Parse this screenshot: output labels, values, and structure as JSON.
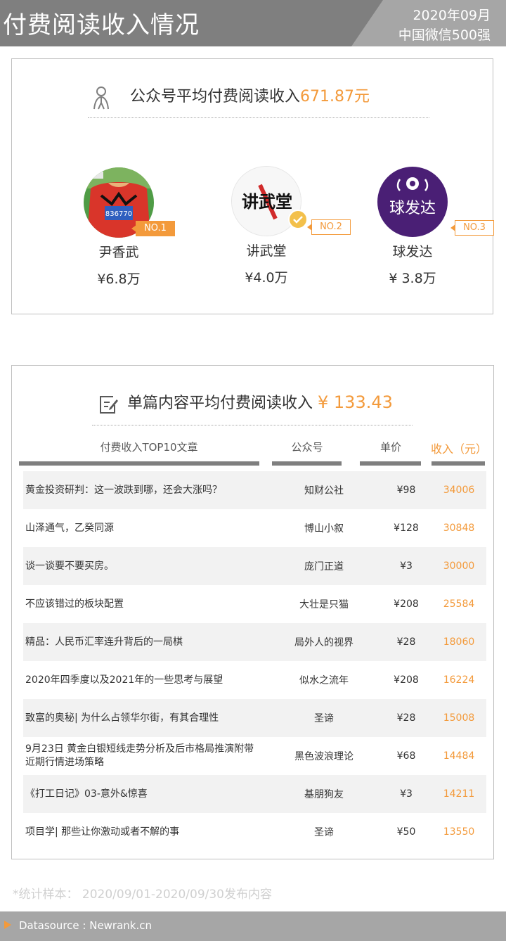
{
  "header": {
    "title": "付费阅读收入情况",
    "date": "2020年09月",
    "subtitle": "中国微信500强"
  },
  "summary": {
    "label": "公众号平均付费阅读收入",
    "value": "671.87元",
    "top_accounts": [
      {
        "rank": "NO.1",
        "name": "尹香武",
        "value": "¥6.8万"
      },
      {
        "rank": "NO.2",
        "name": "讲武堂",
        "value": "¥4.0万"
      },
      {
        "rank": "NO.3",
        "name": "球发达",
        "value": "¥ 3.8万"
      }
    ],
    "avatar_text": {
      "acct2": "讲武堂",
      "acct3": "球发达",
      "bib": "836770"
    }
  },
  "articles": {
    "label": "单篇内容平均付费阅读收入",
    "value": "¥ 133.43",
    "headers": {
      "title": "付费收入TOP10文章",
      "account": "公众号",
      "price": "单价",
      "revenue": "收入（元）"
    },
    "rows": [
      {
        "title": "黄金投资研判：这一波跌到哪，还会大涨吗？",
        "account": "知财公社",
        "price": "¥98",
        "revenue": "34006"
      },
      {
        "title": "山泽通气，乙癸同源",
        "account": "博山小叙",
        "price": "¥128",
        "revenue": "30848"
      },
      {
        "title": "谈一谈要不要买房。",
        "account": "庞门正道",
        "price": "¥3",
        "revenue": "30000"
      },
      {
        "title": "不应该错过的板块配置",
        "account": "大壮是只猫",
        "price": "¥208",
        "revenue": "25584"
      },
      {
        "title": "精品：人民币汇率连升背后的一局棋",
        "account": "局外人的视界",
        "price": "¥28",
        "revenue": "18060"
      },
      {
        "title": "2020年四季度以及2021年的一些思考与展望",
        "account": "似水之流年",
        "price": "¥208",
        "revenue": "16224"
      },
      {
        "title": "致富的奥秘| 为什么占领华尔街，有其合理性",
        "account": "圣谛",
        "price": "¥28",
        "revenue": "15008"
      },
      {
        "title": "9月23日 黄金白银短线走势分析及后市格局推演附带近期行情进场策略",
        "account": "黑色波浪理论",
        "price": "¥68",
        "revenue": "14484"
      },
      {
        "title": "《打工日记》03-意外&惊喜",
        "account": "基朋狗友",
        "price": "¥3",
        "revenue": "14211"
      },
      {
        "title": "项目学| 那些让你激动或者不解的事",
        "account": "圣谛",
        "price": "¥50",
        "revenue": "13550"
      }
    ]
  },
  "note": "*统计样本： 2020/09/01-2020/09/30发布内容",
  "footer": "Datasource : Newrank.cn",
  "colors": {
    "accent": "#f39a3b",
    "header": "#7f7f7f",
    "header_light": "#a6a6a6",
    "row_shade": "#f2f2f2"
  }
}
